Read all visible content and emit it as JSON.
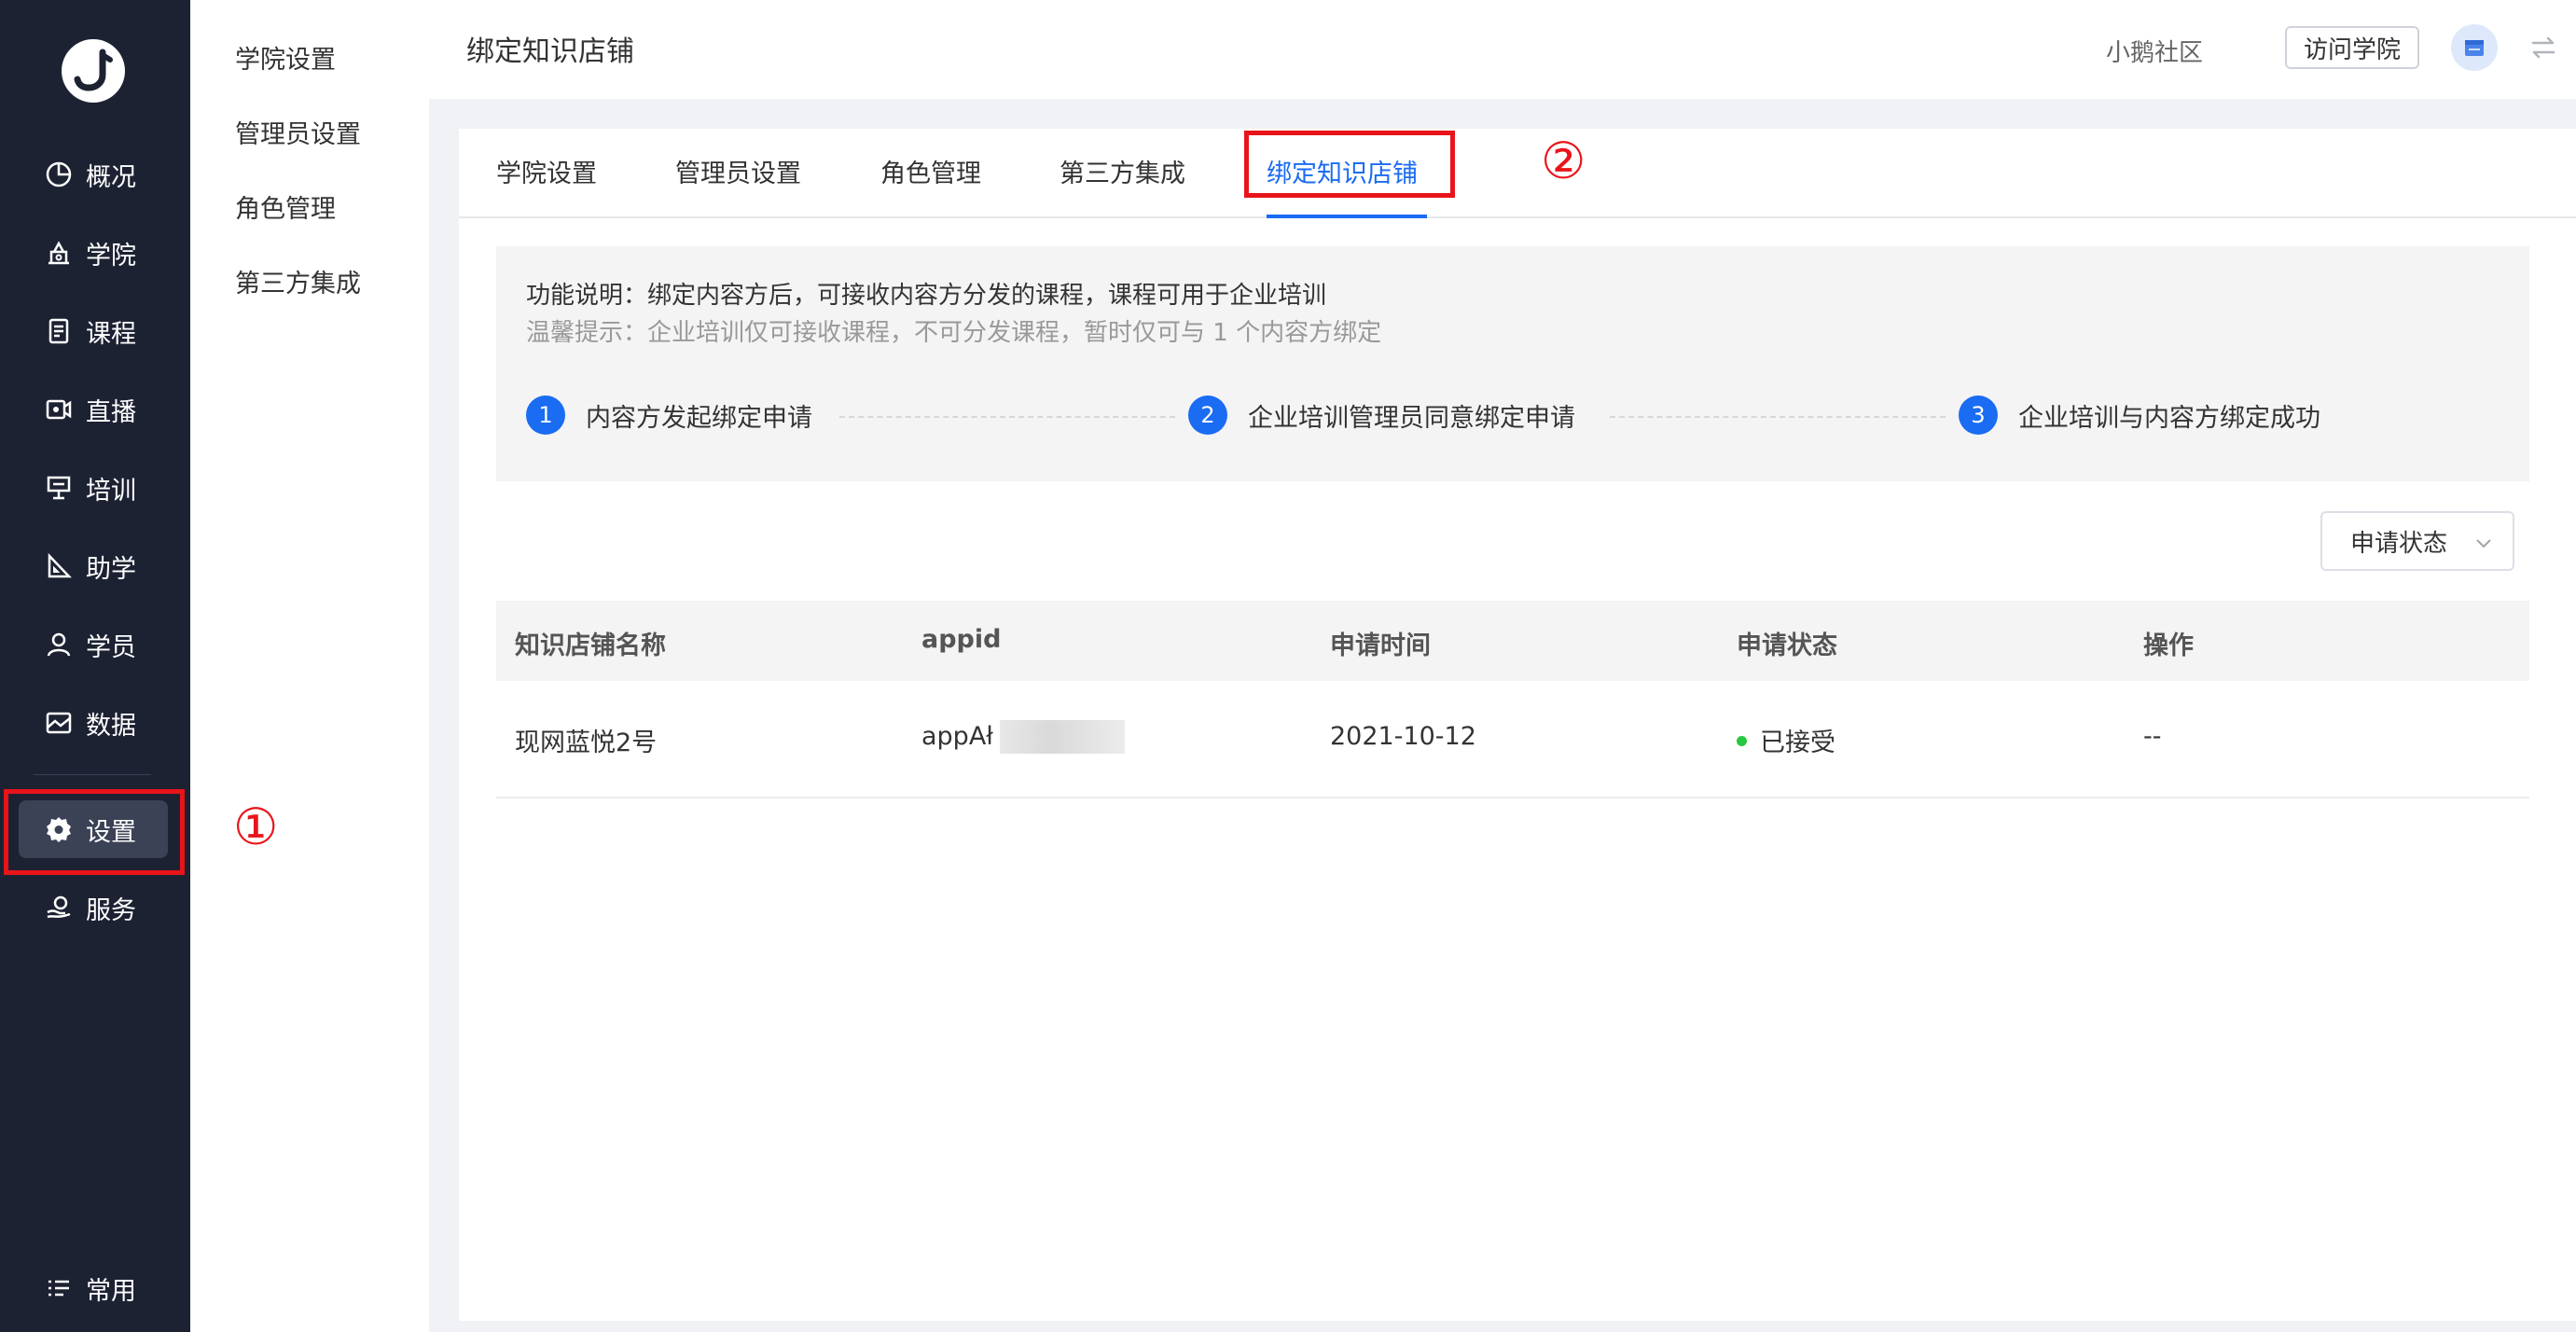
{
  "sidebar": {
    "items": [
      {
        "label": "概况",
        "icon": "pie-chart-icon"
      },
      {
        "label": "学院",
        "icon": "academy-icon"
      },
      {
        "label": "课程",
        "icon": "course-icon"
      },
      {
        "label": "直播",
        "icon": "live-icon"
      },
      {
        "label": "培训",
        "icon": "training-icon"
      },
      {
        "label": "助学",
        "icon": "ruler-icon"
      },
      {
        "label": "学员",
        "icon": "user-icon"
      },
      {
        "label": "数据",
        "icon": "data-icon"
      },
      {
        "label": "设置",
        "icon": "gear-icon"
      },
      {
        "label": "服务",
        "icon": "service-icon"
      }
    ],
    "bottom_label": "常用",
    "active": "设置"
  },
  "submenu": {
    "items": [
      "学院设置",
      "管理员设置",
      "角色管理",
      "第三方集成"
    ]
  },
  "annotations": {
    "one": "①",
    "two": "②"
  },
  "header": {
    "title": "绑定知识店铺",
    "community": "小鹅社区",
    "visit_label": "访问学院"
  },
  "tabs": [
    "学院设置",
    "管理员设置",
    "角色管理",
    "第三方集成",
    "绑定知识店铺"
  ],
  "active_tab": "绑定知识店铺",
  "info": {
    "description": "功能说明：绑定内容方后，可接收内容方分发的课程，课程可用于企业培训",
    "tip": "温馨提示：企业培训仅可接收课程，不可分发课程，暂时仅可与 1 个内容方绑定",
    "steps": [
      {
        "num": "1",
        "label": "内容方发起绑定申请"
      },
      {
        "num": "2",
        "label": "企业培训管理员同意绑定申请"
      },
      {
        "num": "3",
        "label": "企业培训与内容方绑定成功"
      }
    ]
  },
  "filter": {
    "label": "申请状态"
  },
  "table": {
    "columns": [
      "知识店铺名称",
      "appid",
      "申请时间",
      "申请状态",
      "操作"
    ],
    "rows": [
      {
        "name": "现网蓝悦2号",
        "appid": "appAł",
        "time": "2021-10-12",
        "status": "已接受",
        "action": "--"
      }
    ]
  },
  "colors": {
    "accent": "#1a6cf2",
    "sidebar": "#1d2233",
    "annotation": "#e8141a",
    "success": "#28c840"
  }
}
